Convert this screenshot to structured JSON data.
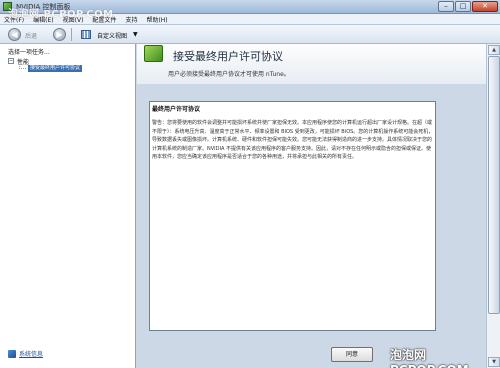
{
  "window": {
    "title": "NVIDIA 控制面板"
  },
  "menu": [
    "文件(F)",
    "编辑(E)",
    "视图(V)",
    "配置文件",
    "支持",
    "帮助(H)"
  ],
  "toolbar": {
    "back_label": "后退",
    "view_label": "自定义视图"
  },
  "left_pane": {
    "header": "选择一项任务...",
    "tree": {
      "root": "性能",
      "child": "接受最终用户许可协议"
    },
    "sysinfo": "系统信息"
  },
  "main": {
    "title": "接受最终用户许可协议",
    "subtitle": "用户必须接受最终用户协议才可使用 nTune。",
    "eula_title": "最终用户许可协议",
    "eula_text": "警告：您将要使用的软件会调整并可能损坏系统并使厂家担保无效。本应用程序使您的计算机运行超出厂家设计规格。在超（或不限于）：系统电压升高、温度高于正常水平、频率设置和 BIOS 受到更改，可能损坏 BIOS。您的计算机操作系统可能会死机，导致数据丢失或图像损坏。计算机系统、硬件和软件担保可能失效。您可能无法获得制造商的进一步支持。具体情况取决于您的计算机系统的制造厂家。NVIDIA 不提供有关该应用程序的客户服务支持。因此，请对不存在任何明示或隐含的担保或保证。使用本软件，您应当确定该应用程序是否适合于您的各种用途，并将承担与此相关的所有责任。",
    "next_button": "同意"
  },
  "watermarks": {
    "top": "泡泡网 PCPOP.COM",
    "bottom": "泡泡网 PCPOP.COM"
  }
}
